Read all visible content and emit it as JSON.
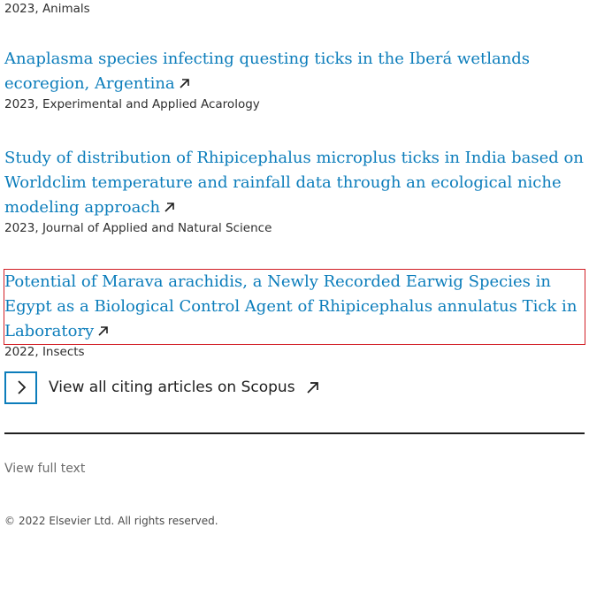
{
  "top_meta": "2023, Animals",
  "articles": [
    {
      "title": "Anaplasma species infecting questing ticks in the Iberá wetlands ecoregion, Argentina",
      "meta": "2023, Experimental and Applied Acarology"
    },
    {
      "title": "Study of distribution of Rhipicephalus microplus ticks in India based on Worldclim temperature and rainfall data through an ecological niche modeling approach",
      "meta": "2023, Journal of Applied and Natural Science"
    },
    {
      "title": "Potential of Marava arachidis, a Newly Recorded Earwig Species in Egypt as a Biological Control Agent of Rhipicephalus annulatus Tick in Laboratory",
      "meta": "2022, Insects"
    }
  ],
  "scopus": {
    "label": "View all citing articles on Scopus",
    "icon": "chevron-right-icon"
  },
  "footer": {
    "full_text": "View full text",
    "copyright_symbol": "©",
    "copyright": "2022 Elsevier Ltd. All rights reserved."
  },
  "colors": {
    "link": "#0c7dbb",
    "highlight": "#d21f26"
  }
}
